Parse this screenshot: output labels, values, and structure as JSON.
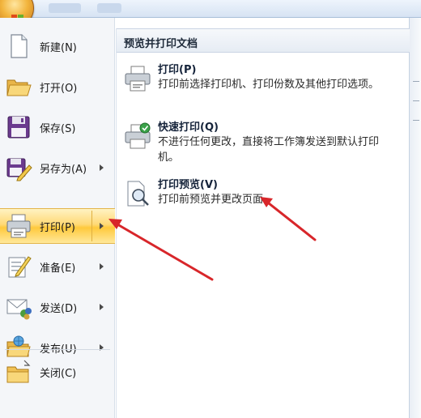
{
  "menu": {
    "items": [
      {
        "label": "新建(N)",
        "icon": "new-document-icon",
        "has_submenu": false
      },
      {
        "label": "打开(O)",
        "icon": "open-folder-icon",
        "has_submenu": false
      },
      {
        "label": "保存(S)",
        "icon": "save-disk-icon",
        "has_submenu": false
      },
      {
        "label": "另存为(A)",
        "icon": "save-as-icon",
        "has_submenu": true
      },
      {
        "label": "打印(P)",
        "icon": "printer-icon",
        "has_submenu": true,
        "active": true
      },
      {
        "label": "准备(E)",
        "icon": "prepare-icon",
        "has_submenu": true
      },
      {
        "label": "发送(D)",
        "icon": "send-icon",
        "has_submenu": true
      },
      {
        "label": "发布(U)",
        "icon": "publish-icon",
        "has_submenu": true
      },
      {
        "label": "关闭(C)",
        "icon": "close-folder-icon",
        "has_submenu": false
      }
    ]
  },
  "submenu": {
    "title": "预览并打印文档",
    "options": [
      {
        "title": "打印(P)",
        "description": "打印前选择打印机、打印份数及其他打印选项。",
        "icon": "printer-icon"
      },
      {
        "title": "快速打印(Q)",
        "description": "不进行任何更改，直接将工作簿发送到默认打印机。",
        "icon": "quick-print-icon"
      },
      {
        "title": "打印预览(V)",
        "description": "打印前预览并更改页面。",
        "icon": "print-preview-icon"
      }
    ]
  },
  "colors": {
    "accent_active": "#ffd977",
    "annotation_arrow": "#d8262a",
    "panel_header": "#e6ecf4"
  }
}
